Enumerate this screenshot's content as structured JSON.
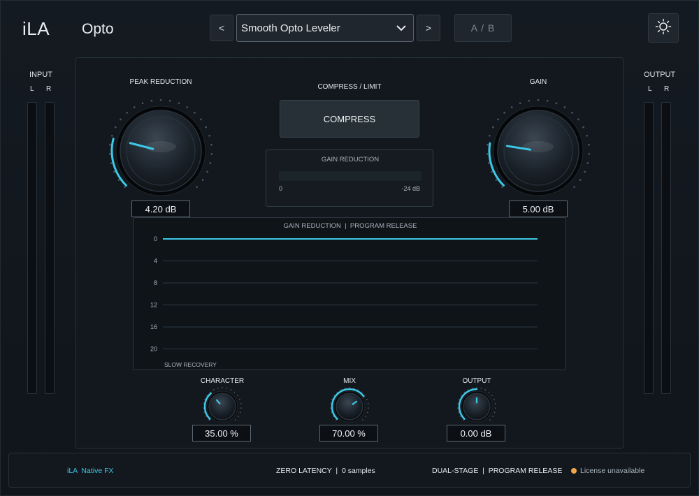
{
  "header": {
    "logo": "iLA",
    "plugin_name": "Opto",
    "preset_prev": "<",
    "preset_next": ">",
    "preset_name": "Smooth Opto Leveler",
    "ab_label": "A / B",
    "settings_icon": "sun-icon"
  },
  "input_meter": {
    "label": "INPUT",
    "left": "L",
    "right": "R"
  },
  "output_meter": {
    "label": "OUTPUT",
    "left": "L",
    "right": "R"
  },
  "peak_reduction": {
    "label": "PEAK REDUCTION",
    "value": "4.20 dB",
    "level": 0.22
  },
  "gain": {
    "label": "GAIN",
    "value": "5.00 dB",
    "level": 0.2
  },
  "mode": {
    "label": "COMPRESS / LIMIT",
    "button": "COMPRESS"
  },
  "gain_reduction_meter": {
    "title": "GAIN REDUCTION",
    "min_label": "0",
    "max_label": "-24 dB",
    "fraction": 0
  },
  "graph": {
    "title": "GAIN REDUCTION  |  PROGRAM RELEASE",
    "footnote": "SLOW RECOVERY",
    "y_ticks": [
      "0",
      "4",
      "8",
      "12",
      "16",
      "20"
    ],
    "trace_value": 0
  },
  "character": {
    "label": "CHARACTER",
    "value": "35.00 %",
    "level": 0.35
  },
  "mix": {
    "label": "MIX",
    "value": "70.00 %",
    "level": 0.7
  },
  "output": {
    "label": "OUTPUT",
    "value": "0.00 dB",
    "level": 0.5
  },
  "footer": {
    "brand": "iLA  Native FX",
    "latency": "ZERO LATENCY  |  0 samples",
    "mode": "DUAL-STAGE  |  PROGRAM RELEASE",
    "license": "License unavailable"
  },
  "colors": {
    "accent": "#3cc8e6",
    "license_dot": "#f2a54a",
    "background": "#12181e"
  }
}
